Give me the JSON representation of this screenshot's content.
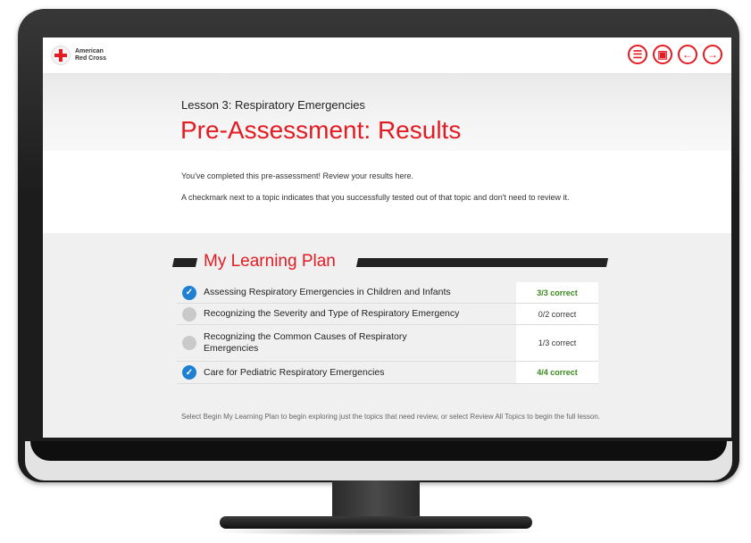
{
  "logo": {
    "line1": "American",
    "line2": "Red Cross"
  },
  "nav": [
    {
      "name": "menu-icon",
      "glyph": "☰"
    },
    {
      "name": "clipboard-icon",
      "glyph": "▣"
    },
    {
      "name": "arrow-left-icon",
      "glyph": "←"
    },
    {
      "name": "arrow-right-icon",
      "glyph": "→"
    }
  ],
  "header": {
    "lesson": "Lesson 3: Respiratory Emergencies",
    "title": "Pre-Assessment: Results"
  },
  "intro": {
    "line1": "You've completed this pre-assessment! Review your results here.",
    "line2": "A checkmark next to a topic indicates that you successfully tested out of that topic and don't need to review it."
  },
  "plan": {
    "title": "My Learning Plan",
    "rows": [
      {
        "topic": "Assessing Respiratory Emergencies in Children and Infants",
        "score": "3/3 correct",
        "passed": true
      },
      {
        "topic": "Recognizing the Severity and Type of Respiratory Emergency",
        "score": "0/2 correct",
        "passed": false
      },
      {
        "topic": "Recognizing the Common Causes of Respiratory Emergencies",
        "score": "1/3 correct",
        "passed": false
      },
      {
        "topic": "Care for Pediatric Respiratory Emergencies",
        "score": "4/4 correct",
        "passed": true
      }
    ]
  },
  "footer": {
    "note": "Select Begin My Learning Plan to begin exploring just the topics that need review, or select Review All Topics to begin the full lesson."
  },
  "colors": {
    "brand_red": "#e31b23",
    "check_blue": "#1f7fd1",
    "pass_green": "#3a8a1c"
  }
}
